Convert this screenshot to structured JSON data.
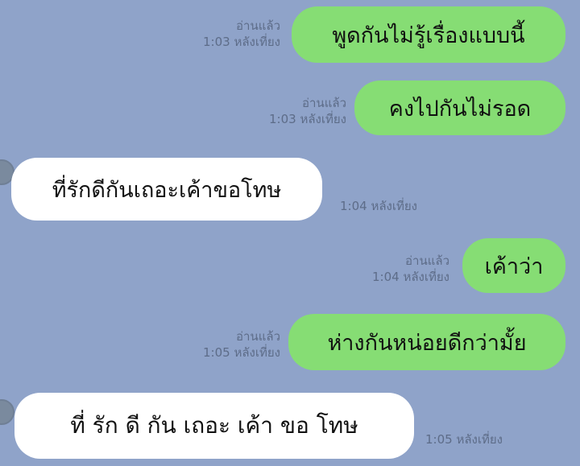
{
  "messages": [
    {
      "side": "sent",
      "text": "พูดกันไม่รู้เรื่องแบบนี้",
      "read": "อ่านแล้ว",
      "time": "1:03 หลังเที่ยง"
    },
    {
      "side": "sent",
      "text": "คงไปกันไม่รอด",
      "read": "อ่านแล้ว",
      "time": "1:03 หลังเที่ยง"
    },
    {
      "side": "received",
      "text": "ที่รักดีกันเถอะเค้าขอโทษ",
      "time": "1:04 หลังเที่ยง"
    },
    {
      "side": "sent",
      "text": "เค้าว่า",
      "read": "อ่านแล้ว",
      "time": "1:04 หลังเที่ยง"
    },
    {
      "side": "sent",
      "text": "ห่างกันหน่อยดีกว่ามั้ย",
      "read": "อ่านแล้ว",
      "time": "1:05 หลังเที่ยง"
    },
    {
      "side": "received",
      "text": "ที่ รัก ดี กัน เถอะ เค้า ขอ โทษ",
      "time": "1:05 หลังเที่ยง"
    }
  ],
  "colors": {
    "background": "#8fa3c9",
    "sent_bubble": "#86dd74",
    "received_bubble": "#ffffff",
    "meta_text": "#5d6c88"
  }
}
